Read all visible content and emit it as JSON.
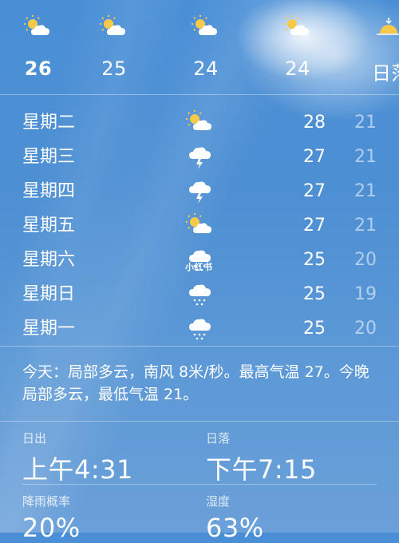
{
  "hourly": [
    {
      "time": "26",
      "icon": "partly-cloudy-icon",
      "bold": true
    },
    {
      "time": "25",
      "icon": "partly-cloudy-icon",
      "bold": false
    },
    {
      "time": "24",
      "icon": "partly-cloudy-icon",
      "bold": false
    },
    {
      "time": "24",
      "icon": "partly-cloudy-icon",
      "bold": false
    },
    {
      "time": "日落",
      "icon": "sunset-icon",
      "bold": false
    }
  ],
  "daily": [
    {
      "day": "星期二",
      "icon": "partly-cloudy-icon",
      "high": "28",
      "low": "21"
    },
    {
      "day": "星期三",
      "icon": "thunderstorm-icon",
      "high": "27",
      "low": "21"
    },
    {
      "day": "星期四",
      "icon": "thunderstorm-icon",
      "high": "27",
      "low": "21"
    },
    {
      "day": "星期五",
      "icon": "partly-cloudy-icon",
      "high": "27",
      "low": "21"
    },
    {
      "day": "星期六",
      "icon": "rain-cloud-icon",
      "high": "25",
      "low": "20"
    },
    {
      "day": "星期日",
      "icon": "rain-cloud-icon",
      "high": "25",
      "low": "19"
    },
    {
      "day": "星期一",
      "icon": "rain-cloud-icon",
      "high": "25",
      "low": "20"
    }
  ],
  "watermark": "小红书",
  "summary": "今天：局部多云，南风 8米/秒。最高气温 27。今晚局部多云，最低气温 21。",
  "details": {
    "sunrise_label": "日出",
    "sunrise_value": "上午4:31",
    "sunset_label": "日落",
    "sunset_value": "下午7:15",
    "rain_label": "降雨概率",
    "rain_value": "20%",
    "humidity_label": "湿度",
    "humidity_value": "63%"
  },
  "colors": {
    "sky": "#4d8fd3",
    "sun": "#f7c948",
    "cloud": "#ffffff",
    "low_temp": "rgba(255,255,255,0.55)"
  }
}
